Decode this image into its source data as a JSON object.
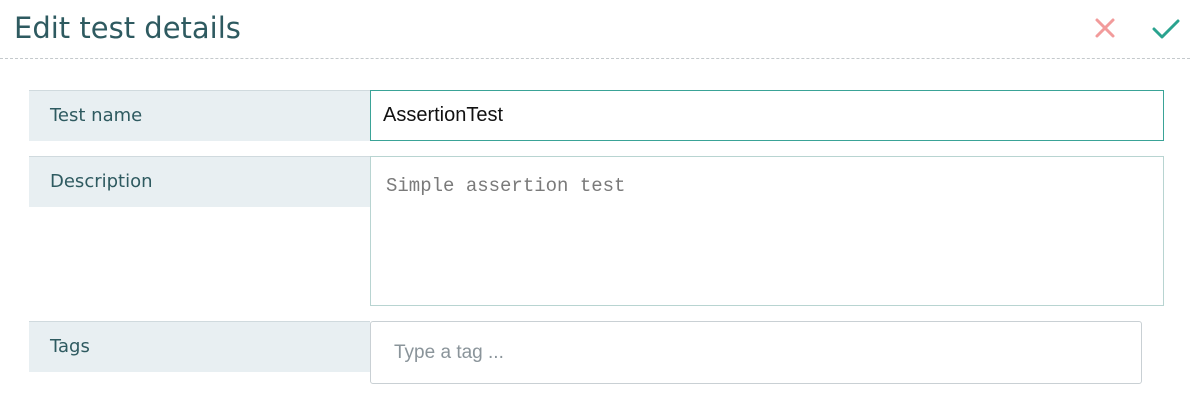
{
  "header": {
    "title": "Edit test details",
    "cancel_icon": "close-icon",
    "confirm_icon": "checkmark-icon"
  },
  "colors": {
    "title": "#2e5a60",
    "cancel": "#f29b9b",
    "confirm": "#2aa38f",
    "label_bg": "#e8eff2",
    "focus_border": "#3aa397"
  },
  "form": {
    "name_label": "Test name",
    "name_value": "AssertionTest",
    "description_label": "Description",
    "description_value": "Simple assertion test",
    "tags_label": "Tags",
    "tags_placeholder": "Type a tag ..."
  }
}
